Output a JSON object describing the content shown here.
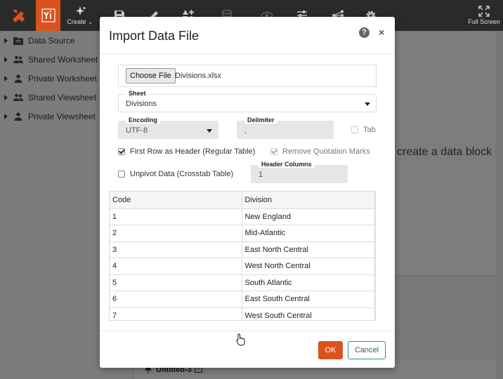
{
  "toolbar": {
    "create_label": "Create",
    "fullscreen_label": "Full Screen"
  },
  "sidebar": {
    "items": [
      {
        "label": "Data Source",
        "icon": "folder-icon"
      },
      {
        "label": "Shared Worksheet",
        "icon": "users-icon"
      },
      {
        "label": "Private Worksheet",
        "icon": "user-icon"
      },
      {
        "label": "Shared Viewsheet",
        "icon": "users-icon"
      },
      {
        "label": "Private Viewsheet",
        "icon": "user-icon"
      }
    ]
  },
  "background": {
    "hint_text": "create a data block",
    "bottom_tab_label": "Untitled-3"
  },
  "dialog": {
    "title": "Import Data File",
    "help_symbol": "?",
    "close_symbol": "×",
    "choose_file_label": "Choose File",
    "file_name": "Divisions.xlsx",
    "sheet": {
      "legend": "Sheet",
      "value": "Divisions"
    },
    "encoding": {
      "legend": "Encoding",
      "value": "UTF-8"
    },
    "delimiter": {
      "legend": "Delimiter",
      "value": ","
    },
    "tab_label": "Tab",
    "first_row_header": {
      "label": "First Row as Header (Regular Table)",
      "checked": true
    },
    "remove_quotes": {
      "label": "Remove Quotation Marks",
      "checked": true
    },
    "unpivot": {
      "label": "Unpivot Data (Crosstab Table)",
      "checked": false
    },
    "header_columns": {
      "legend": "Header Columns",
      "value": "1"
    },
    "table": {
      "columns": [
        "Code",
        "Division"
      ],
      "rows": [
        [
          "1",
          "New England"
        ],
        [
          "2",
          "Mid-Atlantic"
        ],
        [
          "3",
          "East North Central"
        ],
        [
          "4",
          "West North Central"
        ],
        [
          "5",
          "South Atlantic"
        ],
        [
          "6",
          "East South Central"
        ],
        [
          "7",
          "West South Central"
        ]
      ]
    },
    "ok_label": "OK",
    "cancel_label": "Cancel"
  },
  "colors": {
    "accent": "#d9531e",
    "toolbar_bg": "#2a2a2a",
    "cancel_border": "#3b8a8a"
  }
}
